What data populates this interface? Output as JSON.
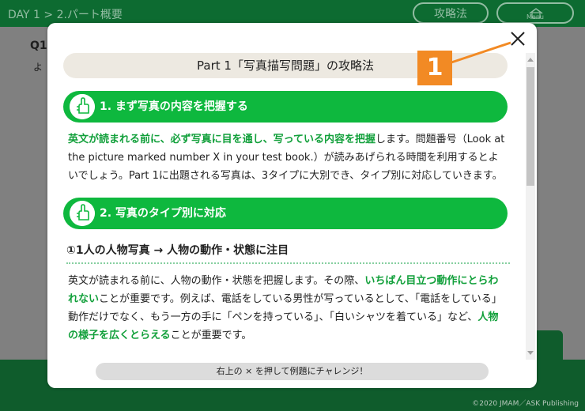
{
  "app": {
    "breadcrumb": "DAY 1 > 2.パート概要",
    "strategy_button": "攻略法",
    "menu_button": "Menu",
    "question_label": "Q1",
    "question_text": "よ",
    "copyright": "©2020 JMAM／ASK Publishing"
  },
  "modal": {
    "title": "Part 1「写真描写問題」の攻略法",
    "section1": {
      "title": "1. まず写真の内容を把握する",
      "p1_hl1": "英文が読まれる前に、必ず写真に目を通し、写っている内容を把握",
      "p1_text1": "します。問題番号（Look at the picture marked number X in your test book.）が読みあげられる時間を利用するとよいでしょう。Part 1に出題される写真は、3タイプに大別でき、タイプ別に対応していきます。"
    },
    "section2": {
      "title": "2. 写真のタイプ別に対応",
      "subhead": "①1人の人物写真 → 人物の動作・状態に注目",
      "p_text1": "英文が読まれる前に、人物の動作・状態を把握します。その際、",
      "p_hl1": "いちばん目立つ動作にとらわれない",
      "p_text2": "ことが重要です。例えば、電話をしている男性が写っているとして、「電話をしている」動作だけでなく、もう一方の手に「ペンを持っている」、「白いシャツを着ている」など、",
      "p_hl2": "人物の様子を広くとらえる",
      "p_text3": "ことが重要です。"
    },
    "footer": "右上の × を押して例題にチャレンジ！"
  },
  "annotation": {
    "label": "1",
    "color": "#f28a24"
  },
  "colors": {
    "accent_green": "#0eb83e",
    "highlight_green": "#12a03b",
    "header_green": "#0d6b31"
  }
}
